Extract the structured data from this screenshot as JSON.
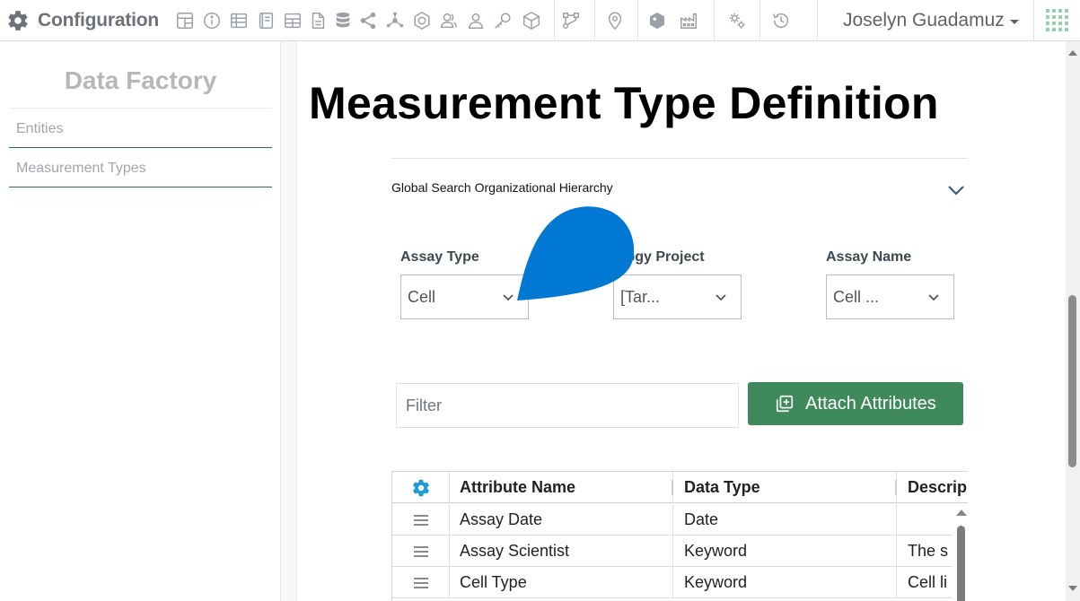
{
  "app": {
    "title": "Configuration",
    "icon": "gear-icon"
  },
  "toolbar": {
    "icons": [
      "dashboard-layout-icon",
      "info-icon",
      "table-icon",
      "notebook-icon",
      "grid-table-icon",
      "document-icon",
      "database-icon",
      "share-icon",
      "network-hub-icon",
      "badge-id-icon",
      "user-group-icon",
      "user-icon",
      "key-icon",
      "cube-icon",
      "workflow-icon",
      "location-pin-icon",
      "hexagon-tag-icon",
      "factory-icon",
      "gears-icon",
      "history-icon"
    ]
  },
  "user": {
    "name": "Joselyn Guadamuz"
  },
  "sidebar": {
    "title": "Data Factory",
    "items": [
      {
        "label": "Entities"
      },
      {
        "label": "Measurement Types"
      }
    ]
  },
  "main": {
    "title": "Measurement Type Definition",
    "section": {
      "title": "Global Search Organizational Hierarchy"
    },
    "filters": [
      {
        "label": "Assay Type",
        "value": "Cell"
      },
      {
        "label": "logy Project",
        "value": "[Tar..."
      },
      {
        "label": "Assay Name",
        "value": "Cell ..."
      }
    ],
    "filter_input": {
      "placeholder": "Filter",
      "value": ""
    },
    "attach_button": {
      "label": "Attach Attributes"
    },
    "grid": {
      "columns": [
        "Attribute Name",
        "Data Type",
        "Descrip"
      ],
      "rows": [
        {
          "name": "Assay Date",
          "type": "Date",
          "description": ""
        },
        {
          "name": "Assay Scientist",
          "type": "Keyword",
          "description": "The s"
        },
        {
          "name": "Cell Type",
          "type": "Keyword",
          "description": "Cell li"
        }
      ]
    }
  },
  "colors": {
    "accent_green": "#3f8a5b",
    "nav_underline": "#2e6b57",
    "pin_blue": "#0078d4",
    "settings_blue": "#1a9ad6"
  }
}
